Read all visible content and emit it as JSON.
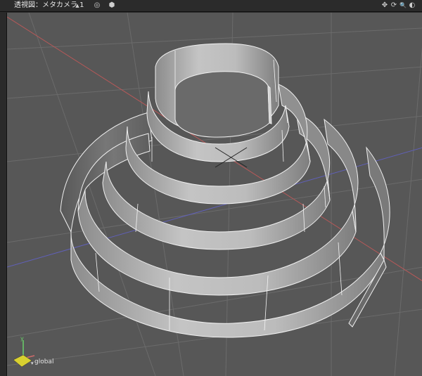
{
  "header": {
    "view_title": "透視図：メタカメラ 1",
    "menu_caret": "▲",
    "icons": {
      "target": "◎",
      "cube": "⬢",
      "pan": "✥",
      "rotate": "⟳",
      "zoom": "🔍",
      "shade": "◐"
    }
  },
  "viewport": {
    "coordinate_system": "global",
    "background_color": "#575757",
    "grid_color": "#6a6a6a",
    "axis_x_color": "#c85a5a",
    "axis_z_color": "#5a5ac8",
    "surface_color": "#a9a9a9"
  }
}
